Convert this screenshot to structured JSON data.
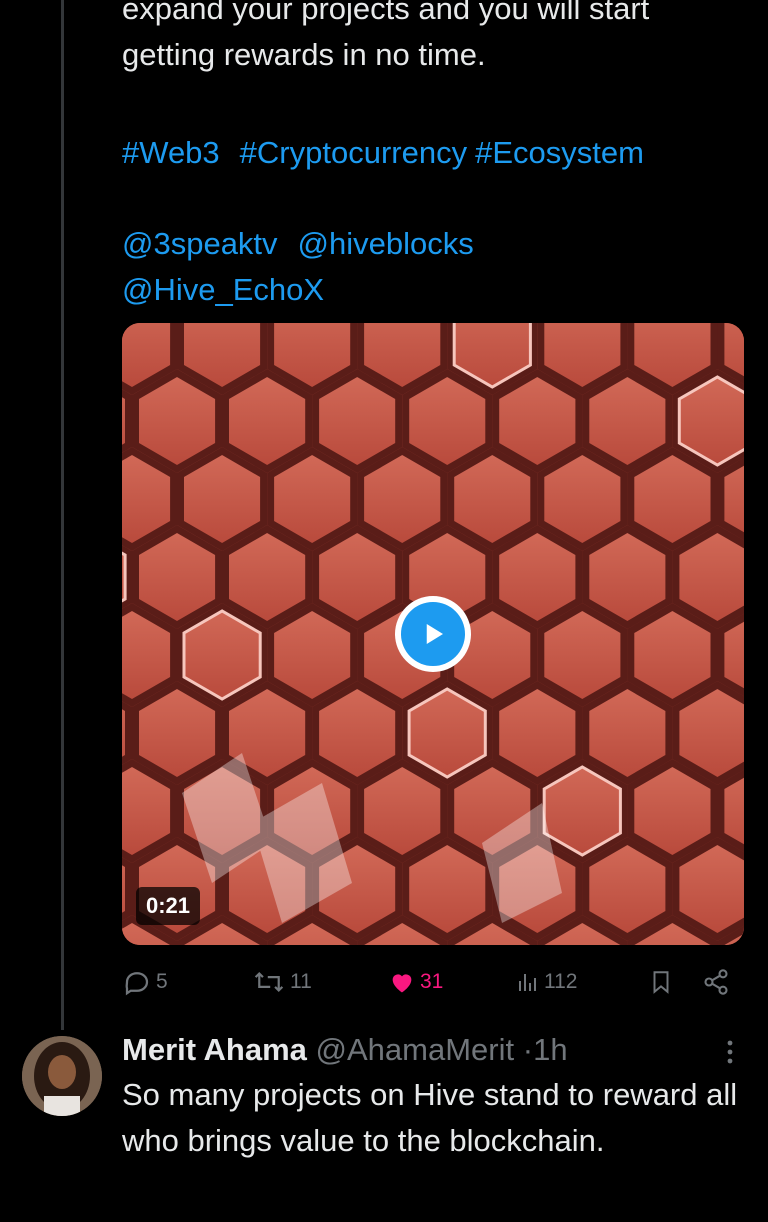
{
  "tweet": {
    "text_line1": "expand your projects and you will start",
    "text_line2": "getting rewards in no time.",
    "hashtags": [
      "#Web3",
      "#Cryptocurrency",
      "#Ecosystem"
    ],
    "mentions_row1": [
      "@3speaktv",
      "@hiveblocks"
    ],
    "mentions_row2": [
      "@Hive_EchoX"
    ],
    "media": {
      "duration": "0:21",
      "play_icon": "play-icon"
    },
    "stats": {
      "replies": "5",
      "reposts": "11",
      "likes": "31",
      "views": "112"
    },
    "accent": "#1d9bf0",
    "like_color": "#f91880"
  },
  "reply": {
    "name": "Merit Ahama",
    "handle": "@AhamaMerit",
    "separator": "·",
    "time": "1h",
    "text": "So many projects on Hive stand to reward all who brings value to the blockchain."
  }
}
